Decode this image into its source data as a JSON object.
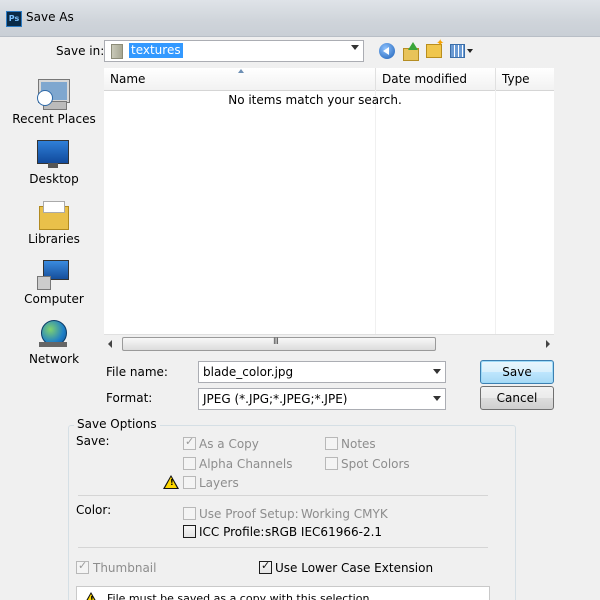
{
  "window": {
    "title": "Save As",
    "app_icon": "ps-app-icon"
  },
  "toolbar": {
    "save_in_label": "Save in:",
    "save_in_value": "textures",
    "icons": [
      "back-icon",
      "up-folder-icon",
      "new-folder-icon",
      "view-menu-icon"
    ]
  },
  "places": [
    {
      "label": "Recent Places",
      "icon": "recent-places-icon"
    },
    {
      "label": "Desktop",
      "icon": "desktop-icon"
    },
    {
      "label": "Libraries",
      "icon": "libraries-icon"
    },
    {
      "label": "Computer",
      "icon": "computer-icon"
    },
    {
      "label": "Network",
      "icon": "network-icon"
    }
  ],
  "filelist": {
    "columns": [
      "Name",
      "Date modified",
      "Type"
    ],
    "empty_message": "No items match your search.",
    "scroll_grip": "III"
  },
  "form": {
    "file_name_label": "File name:",
    "file_name_value": "blade_color.jpg",
    "format_label": "Format:",
    "format_value": "JPEG (*.JPG;*.JPEG;*.JPE)",
    "save_button": "Save",
    "cancel_button": "Cancel"
  },
  "options": {
    "title": "Save Options",
    "save_label": "Save:",
    "as_copy": "As a Copy",
    "notes": "Notes",
    "alpha_channels": "Alpha Channels",
    "spot_colors": "Spot Colors",
    "layers": "Layers",
    "color_label": "Color:",
    "use_proof_setup": "Use Proof Setup:",
    "proof_value": "Working CMYK",
    "icc_profile": "ICC Profile:",
    "icc_value": "sRGB IEC61966-2.1",
    "thumbnail": "Thumbnail",
    "lower_case_ext": "Use Lower Case Extension",
    "warning_text": "File must be saved as a copy with this selection."
  }
}
